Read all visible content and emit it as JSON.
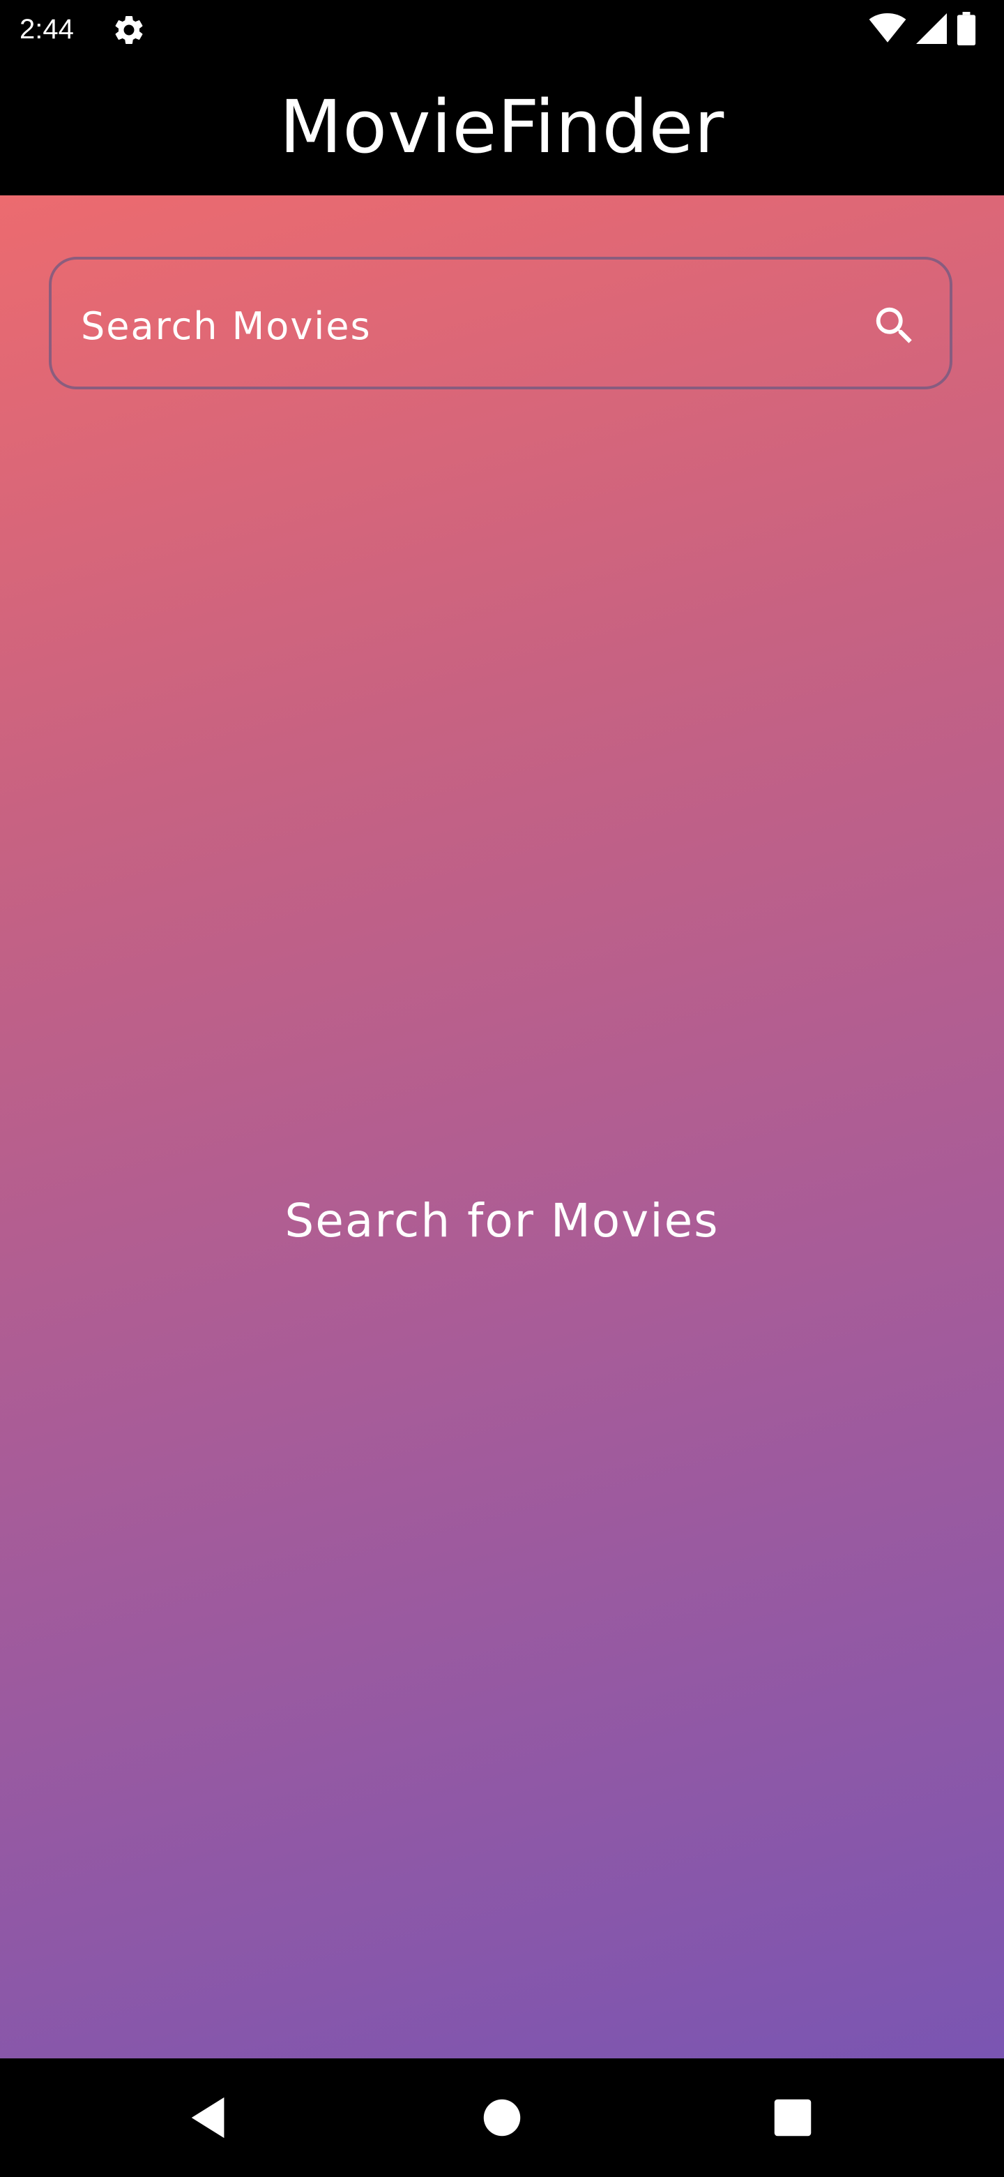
{
  "status_bar": {
    "time": "2:44",
    "icons": [
      "gear-icon",
      "wifi-icon",
      "signal-icon",
      "battery-icon"
    ]
  },
  "app": {
    "title": "MovieFinder"
  },
  "search": {
    "placeholder": "Search Movies",
    "value": "",
    "icon": "search-icon"
  },
  "empty_state": {
    "message": "Search for Movies"
  },
  "nav_bar": {
    "buttons": [
      "back-icon",
      "home-icon",
      "recents-icon"
    ]
  },
  "colors": {
    "gradient_start": "#ec6b6f",
    "gradient_end": "#7a55b2",
    "bars": "#000000",
    "text": "#ffffff"
  }
}
